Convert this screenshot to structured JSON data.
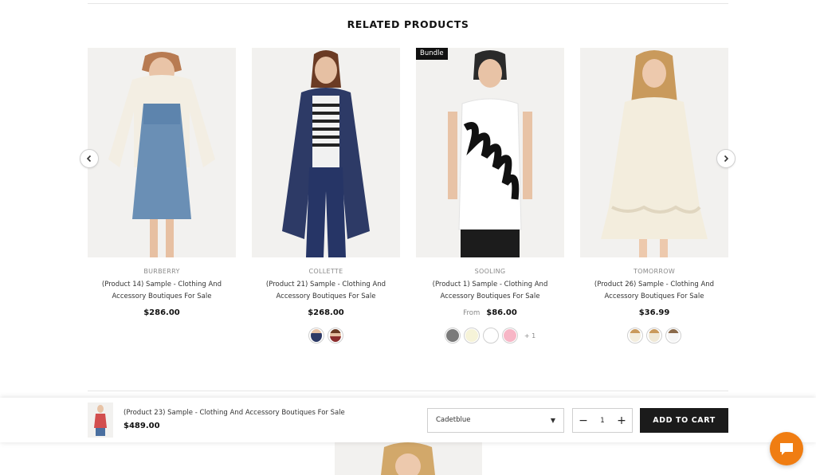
{
  "section": {
    "title": "RELATED PRODUCTS"
  },
  "carousel": {
    "prev_icon": "chevron-left-icon",
    "next_icon": "chevron-right-icon"
  },
  "products": [
    {
      "vendor": "BURBERRY",
      "name_line1": "(Product 14) Sample - Clothing And",
      "name_line2": "Accessory Boutiques For Sale",
      "price": "$286.00",
      "price_prefix": "",
      "badge": ""
    },
    {
      "vendor": "COLLETTE",
      "name_line1": "(Product 21) Sample - Clothing And",
      "name_line2": "Accessory Boutiques For Sale",
      "price": "$268.00",
      "price_prefix": "",
      "badge": ""
    },
    {
      "vendor": "SOOLING",
      "name_line1": "(Product 1) Sample - Clothing And",
      "name_line2": "Accessory Boutiques For Sale",
      "price": "$86.00",
      "price_prefix": "From",
      "badge": "Bundle",
      "more_swatches": "+ 1",
      "swatch_colors": [
        "#7a7a7a",
        "#f6f3d8",
        "#ffffff",
        "#f7b6c6"
      ]
    },
    {
      "vendor": "TOMORROW",
      "name_line1": "(Product 26) Sample - Clothing And",
      "name_line2": "Accessory Boutiques For Sale",
      "price": "$36.99",
      "price_prefix": "",
      "badge": ""
    }
  ],
  "sticky_bar": {
    "product_name": "(Product 23) Sample - Clothing And Accessory Boutiques For Sale",
    "price": "$489.00",
    "variant": "Cadetblue",
    "quantity": "1",
    "add_to_cart": "ADD TO CART"
  },
  "chat": {
    "icon": "chat-bubble-icon",
    "color": "#f07d12"
  }
}
